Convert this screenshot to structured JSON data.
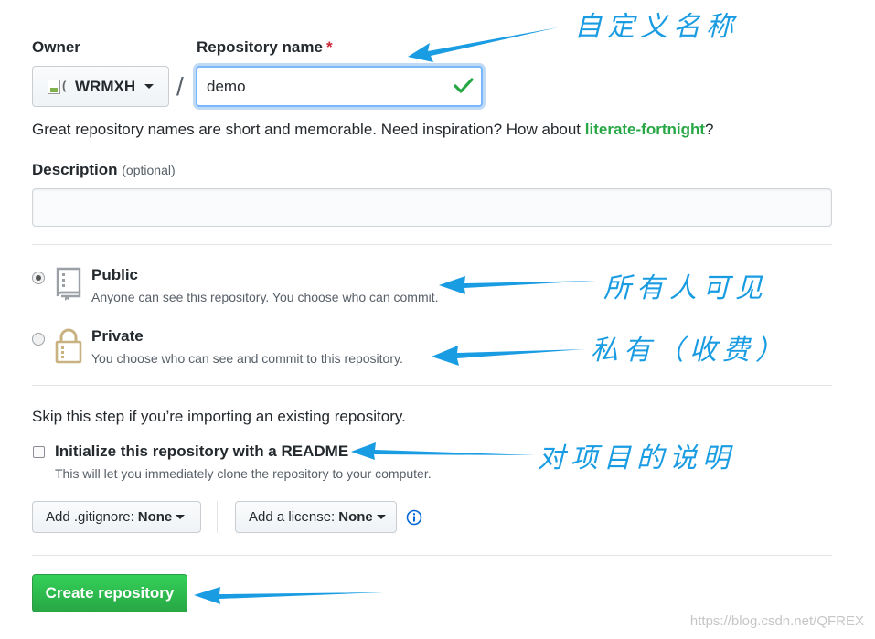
{
  "owner": {
    "label": "Owner",
    "broken_alt": "(",
    "value": "WRMXH"
  },
  "repo_name": {
    "label": "Repository name",
    "required_mark": "*",
    "value": "demo"
  },
  "separator": "/",
  "hint": {
    "prefix": "Great repository names are short and memorable. Need inspiration? How about ",
    "suggestion": "literate-fortnight",
    "suffix": "?"
  },
  "description": {
    "label": "Description",
    "optional": "(optional)"
  },
  "visibility": {
    "public": {
      "title": "Public",
      "subtitle": "Anyone can see this repository. You choose who can commit.",
      "selected": true
    },
    "private": {
      "title": "Private",
      "subtitle": "You choose who can see and commit to this repository.",
      "selected": false
    }
  },
  "init": {
    "skip_text": "Skip this step if you’re importing an existing repository.",
    "readme_label": "Initialize this repository with a README",
    "readme_help": "This will let you immediately clone the repository to your computer."
  },
  "gitignore": {
    "prefix": "Add .gitignore:",
    "value": "None"
  },
  "license": {
    "prefix": "Add a license:",
    "value": "None"
  },
  "create_button": "Create repository",
  "annotations": {
    "name": "自定义名称",
    "public": "所有人可见",
    "private": "私有（收费）",
    "readme": "对项目的说明"
  },
  "watermark": "https://blog.csdn.net/QFREX",
  "colors": {
    "accent_green": "#28a745",
    "annotation_blue": "#1a9ce3",
    "focus_blue": "#79b8ff"
  }
}
